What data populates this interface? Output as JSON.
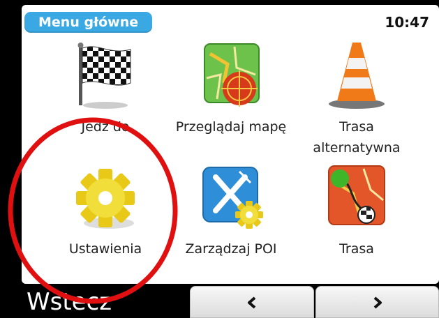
{
  "header": {
    "title": "Menu główne",
    "clock": "10:47"
  },
  "menu": [
    {
      "label": "Jedź do",
      "icon": "checkered-flag-icon"
    },
    {
      "label": "Przeglądaj mapę",
      "icon": "map-browse-icon"
    },
    {
      "label": "Trasa alternatywna",
      "icon": "traffic-cone-icon"
    },
    {
      "label": "Ustawienia",
      "icon": "gear-icon"
    },
    {
      "label": "Zarządzaj POI",
      "icon": "poi-fork-knife-icon"
    },
    {
      "label": "Trasa",
      "icon": "route-map-icon"
    }
  ],
  "footer": {
    "back_label": "Wstecz",
    "prev_icon": "chevron-left-icon",
    "next_icon": "chevron-right-icon"
  },
  "annotation": {
    "color": "#e01010"
  },
  "colors": {
    "title_pill": "#3aa9e3",
    "bar": "#000000"
  }
}
